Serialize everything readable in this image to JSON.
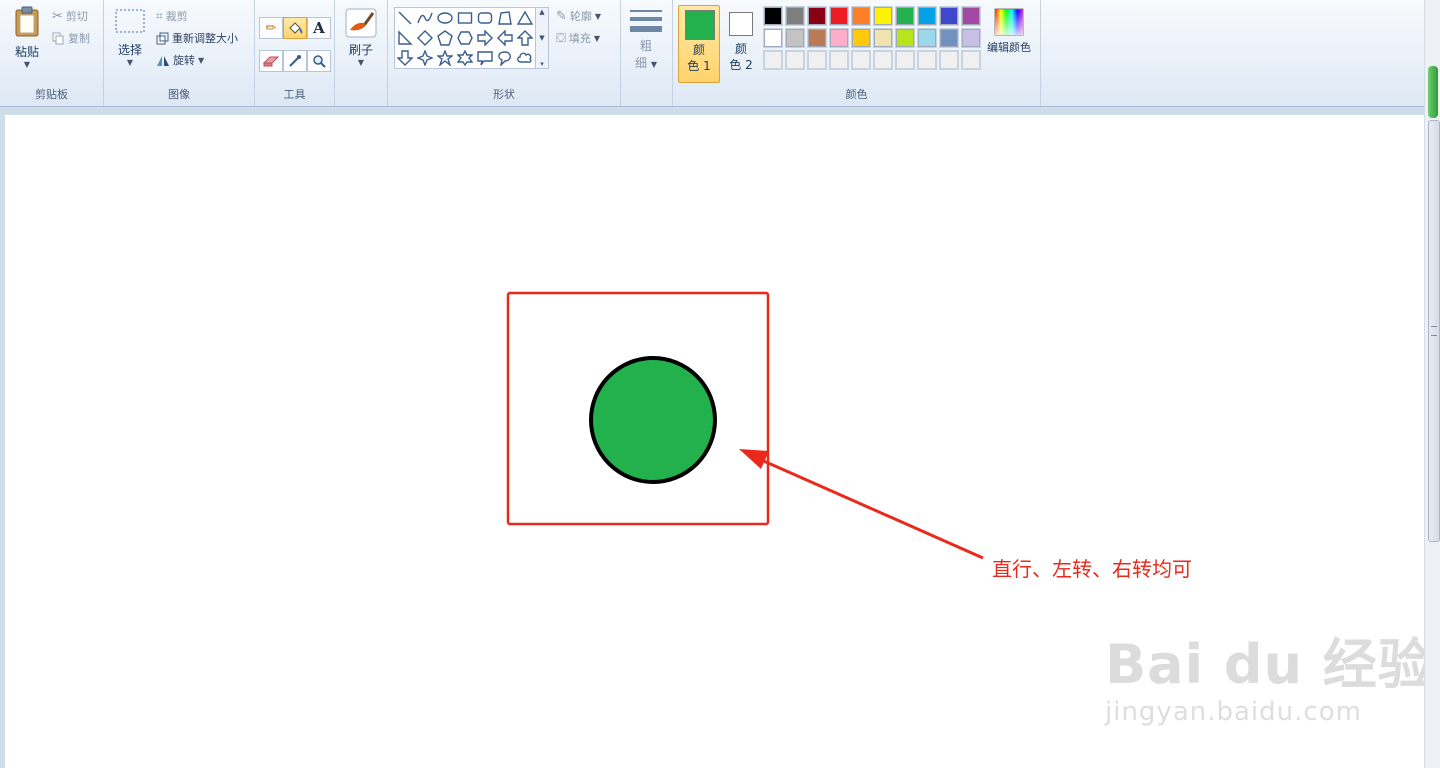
{
  "ribbon": {
    "clipboard": {
      "label": "剪贴板",
      "paste": "粘贴",
      "cut": "剪切",
      "copy": "复制"
    },
    "image": {
      "label": "图像",
      "select": "选择",
      "crop": "裁剪",
      "resize": "重新调整大小",
      "rotate": "旋转"
    },
    "tools": {
      "label": "工具"
    },
    "brushes": {
      "label": "刷子"
    },
    "shapes": {
      "label": "形状",
      "outline": "轮廓",
      "fill": "填充"
    },
    "size": {
      "label_line1": "粗",
      "label_line2": "细"
    },
    "colors": {
      "label": "颜色",
      "color1_line1": "颜",
      "color1_line2": "色 1",
      "color2_line1": "颜",
      "color2_line2": "色 2",
      "edit_colors": "编辑颜色",
      "color1_value": "#22b14c",
      "color2_value": "#ffffff",
      "palette_row1": [
        "#000000",
        "#7f7f7f",
        "#880015",
        "#ed1c24",
        "#ff7f27",
        "#fff200",
        "#22b14c",
        "#00a2e8",
        "#3f48cc",
        "#a349a4"
      ],
      "palette_row2": [
        "#ffffff",
        "#c3c3c3",
        "#b97a57",
        "#ffaec9",
        "#ffc90e",
        "#efe4b0",
        "#b5e61d",
        "#99d9ea",
        "#7092be",
        "#c8bfe7"
      ],
      "palette_row3": [
        "#f0f0f0",
        "#f0f0f0",
        "#f0f0f0",
        "#f0f0f0",
        "#f0f0f0",
        "#f0f0f0",
        "#f0f0f0",
        "#f0f0f0",
        "#f0f0f0",
        "#f0f0f0"
      ]
    }
  },
  "canvas": {
    "annotation_text": "直行、左转、右转均可",
    "circle_fill": "#22b14c",
    "frame_color": "#e8291c"
  },
  "watermark": {
    "brand": "Bai du 经验",
    "url": "jingyan.baidu.com"
  }
}
